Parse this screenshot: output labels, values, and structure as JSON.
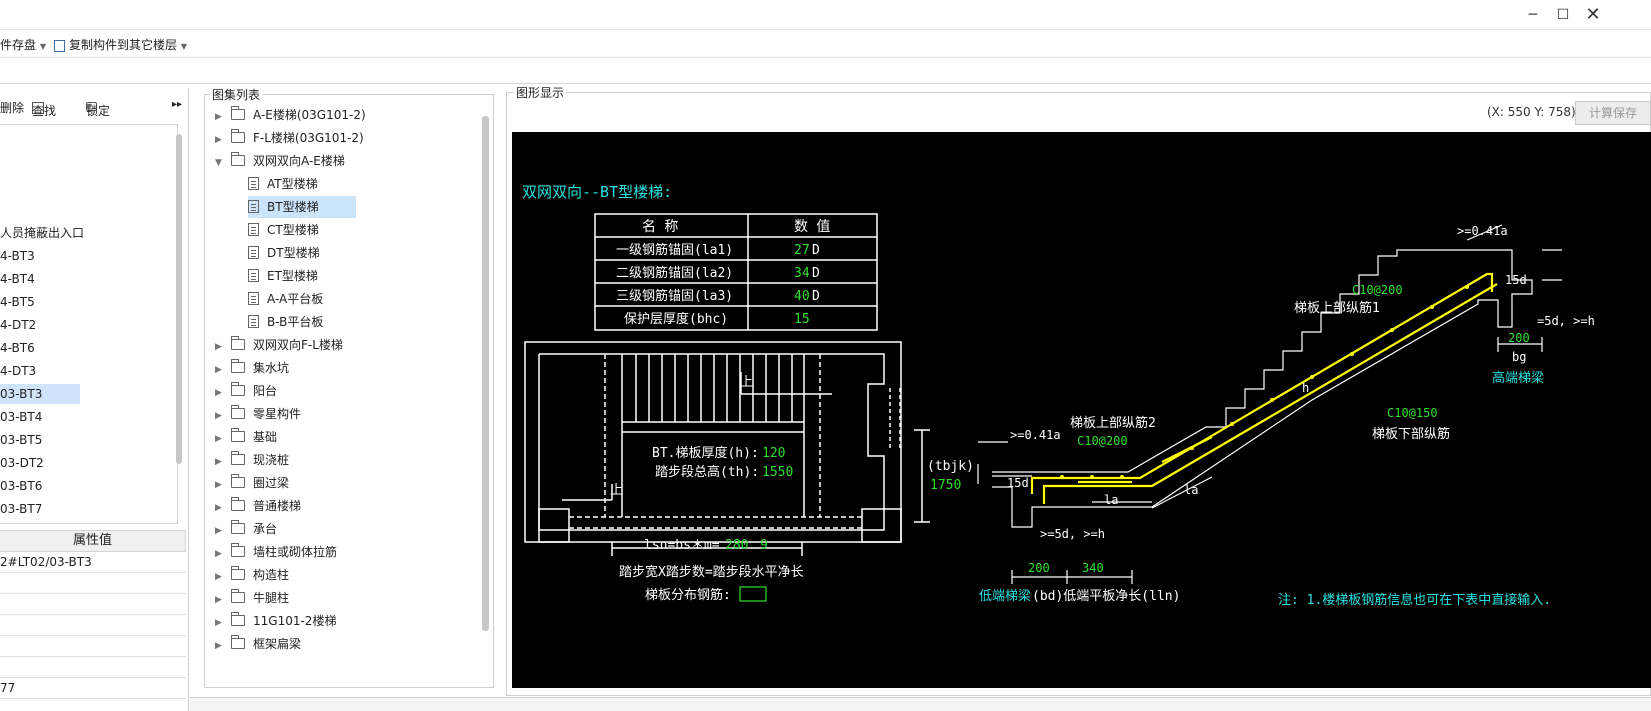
{
  "toolbar": {
    "save_label": "件存盘",
    "copy_label": "复制构件到其它楼层"
  },
  "left": {
    "delete_label": "删除",
    "find_label": "查找",
    "lock_label": "锁定",
    "items": [
      "人员掩蔽出入口",
      "4-BT3",
      "4-BT4",
      "4-BT5",
      "4-DT2",
      "4-BT6",
      "4-DT3",
      "03-BT3",
      "03-BT4",
      "03-BT5",
      "03-DT2",
      "03-BT6",
      "03-BT7"
    ],
    "prop_header": "属性值",
    "prop_rows": [
      "2#LT02/03-BT3",
      "",
      "",
      "",
      "",
      "",
      "77"
    ]
  },
  "tree": {
    "title": "图集列表",
    "items": [
      {
        "label": "A-E楼梯(03G101-2)",
        "type": "folder",
        "expanded": false
      },
      {
        "label": "F-L楼梯(03G101-2)",
        "type": "folder",
        "expanded": false
      },
      {
        "label": "双网双向A-E楼梯",
        "type": "folder",
        "expanded": true
      },
      {
        "label": "AT型楼梯",
        "type": "doc"
      },
      {
        "label": "BT型楼梯",
        "type": "doc",
        "selected": true
      },
      {
        "label": "CT型楼梯",
        "type": "doc"
      },
      {
        "label": "DT型楼梯",
        "type": "doc"
      },
      {
        "label": "ET型楼梯",
        "type": "doc"
      },
      {
        "label": "A-A平台板",
        "type": "doc"
      },
      {
        "label": "B-B平台板",
        "type": "doc"
      },
      {
        "label": "双网双向F-L楼梯",
        "type": "folder",
        "expanded": false
      },
      {
        "label": "集水坑",
        "type": "folder",
        "expanded": false
      },
      {
        "label": "阳台",
        "type": "folder",
        "expanded": false
      },
      {
        "label": "零星构件",
        "type": "folder",
        "expanded": false
      },
      {
        "label": "基础",
        "type": "folder",
        "expanded": false
      },
      {
        "label": "现浇桩",
        "type": "folder",
        "expanded": false
      },
      {
        "label": "圈过梁",
        "type": "folder",
        "expanded": false
      },
      {
        "label": "普通楼梯",
        "type": "folder",
        "expanded": false
      },
      {
        "label": "承台",
        "type": "folder",
        "expanded": false
      },
      {
        "label": "墙柱或砌体拉筋",
        "type": "folder",
        "expanded": false
      },
      {
        "label": "构造柱",
        "type": "folder",
        "expanded": false
      },
      {
        "label": "牛腿柱",
        "type": "folder",
        "expanded": false
      },
      {
        "label": "11G101-2楼梯",
        "type": "folder",
        "expanded": false
      },
      {
        "label": "框架扁梁",
        "type": "folder",
        "expanded": false
      }
    ]
  },
  "drawing": {
    "title": "图形显示",
    "coords": "(X: 550 Y: 758)",
    "calc_save": "计算保存",
    "heading": "双网双向--BT型楼梯:",
    "table_headers": [
      "名 称",
      "数 值"
    ],
    "table_rows": [
      {
        "name": "一级钢筋锚固(la1)",
        "value": "27",
        "unit": "D"
      },
      {
        "name": "二级钢筋锚固(la2)",
        "value": "34",
        "unit": "D"
      },
      {
        "name": "三级钢筋锚固(la3)",
        "value": "40",
        "unit": "D"
      },
      {
        "name": "保护层厚度(bhc)",
        "value": "15",
        "unit": ""
      }
    ],
    "plan_thickness_label": "BT.梯板厚度(h):",
    "plan_thickness_value": "120",
    "plan_height_label": "踏步段总高(th):",
    "plan_height_value": "1550",
    "plan_up1": "上",
    "plan_up2": "上",
    "tbjk_label": "(tbjk)",
    "tbjk_value": "1750",
    "lsn_label": "lsn=bs＊m=",
    "lsn_bs": "280",
    "lsn_m": "9",
    "formula": "踏步宽X踏步数=踏步段水平净长",
    "dist_rebar_label": "梯板分布钢筋:",
    "ge_04la_top": ">=0.41a",
    "c10_200_top": "C10@200",
    "top_rebar1": "梯板上部纵筋1",
    "d15_top": "15d",
    "ge_5d_top": "=5d, >=h",
    "v200_top": "200",
    "bg_label": "bg",
    "high_beam": "高端梯梁",
    "h_label": "h",
    "c10_150": "C10@150",
    "bottom_rebar": "梯板下部纵筋",
    "top_rebar2": "梯板上部纵筋2",
    "ge_04la_left": ">=0.41a",
    "c10_200_left": "C10@200",
    "d15_left": "15d",
    "la1": "la",
    "la2": "la",
    "ge_5d_bottom": ">=5d, >=h",
    "v200_bottom": "200",
    "v340": "340",
    "low_beam": "低端梯梁",
    "bd_label": "(bd)低端平板净长(lln)",
    "note": "注: 1.楼梯板钢筋信息也可在下表中直接输入."
  },
  "colors": {
    "canvas_bg": "#000000",
    "cyan": "#27e1e1",
    "green": "#2fe02f",
    "yellow": "#ffff00",
    "white": "#ffffff",
    "selection": "#cce4fb"
  }
}
